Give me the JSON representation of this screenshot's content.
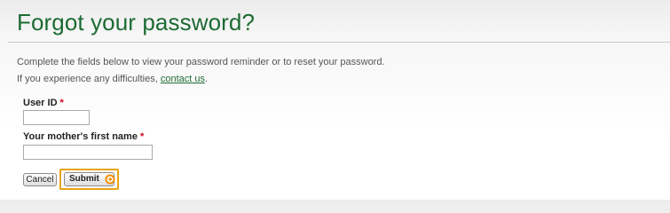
{
  "page": {
    "title": "Forgot your password?"
  },
  "intro": {
    "line1": "Complete the fields below to view your password reminder or to reset your password.",
    "line2_prefix": "If you experience any difficulties, ",
    "contact_link": "contact us",
    "line2_suffix": "."
  },
  "form": {
    "user_id": {
      "label": "User ID",
      "required_marker": "*",
      "value": ""
    },
    "mother_name": {
      "label": "Your mother's first name",
      "required_marker": "*",
      "value": ""
    }
  },
  "actions": {
    "cancel_label": "Cancel",
    "submit_label": "Submit",
    "submit_icon": "arrow-right-circle-icon"
  },
  "colors": {
    "brand_green": "#1d6b33",
    "required_red": "#d0021b",
    "highlight_orange": "#e8a317",
    "submit_icon_orange": "#f08a00"
  }
}
